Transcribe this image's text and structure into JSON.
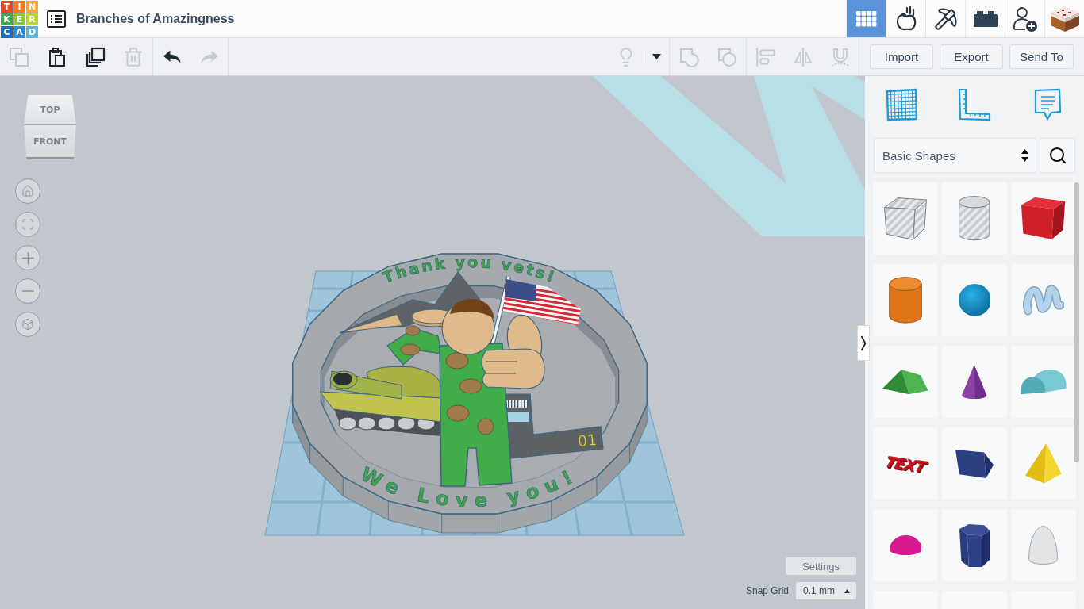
{
  "header": {
    "logo": [
      {
        "char": "T",
        "color": "#e8482c"
      },
      {
        "char": "I",
        "color": "#f47b20"
      },
      {
        "char": "N",
        "color": "#f8a33b"
      },
      {
        "char": "K",
        "color": "#3daa48"
      },
      {
        "char": "E",
        "color": "#8cc63f"
      },
      {
        "char": "R",
        "color": "#bcd431"
      },
      {
        "char": "C",
        "color": "#1a6bb8"
      },
      {
        "char": "A",
        "color": "#2e8bd5"
      },
      {
        "char": "D",
        "color": "#5cb3e2"
      }
    ],
    "title": "Branches of Amazingness",
    "view_modes": [
      {
        "kind": "design",
        "selected": true
      },
      {
        "kind": "sim",
        "selected": false
      },
      {
        "kind": "minecraft",
        "selected": false
      },
      {
        "kind": "bricks",
        "selected": false
      }
    ]
  },
  "toolbar": {
    "edit": [
      {
        "kind": "copy",
        "disabled": true
      },
      {
        "kind": "paste",
        "disabled": false
      },
      {
        "kind": "duplicate",
        "disabled": false
      },
      {
        "kind": "delete",
        "disabled": true
      }
    ],
    "history": [
      {
        "kind": "undo",
        "disabled": false
      },
      {
        "kind": "redo",
        "disabled": true
      }
    ],
    "visibility": {
      "disabled": true
    },
    "shape_tools": [
      {
        "kind": "group",
        "disabled": true
      },
      {
        "kind": "ungroup",
        "disabled": true
      }
    ],
    "arrange_tools": [
      {
        "kind": "align",
        "disabled": true
      },
      {
        "kind": "mirror",
        "disabled": true
      },
      {
        "kind": "cruise",
        "disabled": true
      }
    ],
    "actions": [
      "Import",
      "Export",
      "Send To"
    ]
  },
  "viewport": {
    "view_cube": {
      "top": "TOP",
      "front": "FRONT"
    },
    "model": {
      "top_text": "Thank you vets!",
      "bottom_text": "We Love you!",
      "hull_number": "01"
    },
    "settings": "Settings",
    "snap_grid": {
      "label": "Snap Grid",
      "value": "0.1 mm"
    }
  },
  "panel": {
    "category": "Basic Shapes",
    "shapes": [
      {
        "kind": "box_hole"
      },
      {
        "kind": "cylinder_hole"
      },
      {
        "kind": "box"
      },
      {
        "kind": "cylinder"
      },
      {
        "kind": "sphere"
      },
      {
        "kind": "scribble"
      },
      {
        "kind": "roof"
      },
      {
        "kind": "cone"
      },
      {
        "kind": "round_roof"
      },
      {
        "kind": "text",
        "label": "TEXT"
      },
      {
        "kind": "wedge"
      },
      {
        "kind": "pyramid"
      },
      {
        "kind": "half_sphere"
      },
      {
        "kind": "polygon"
      },
      {
        "kind": "paraboloid"
      },
      {
        "kind": "cut"
      },
      {
        "kind": "cut"
      },
      {
        "kind": "cut"
      }
    ]
  }
}
